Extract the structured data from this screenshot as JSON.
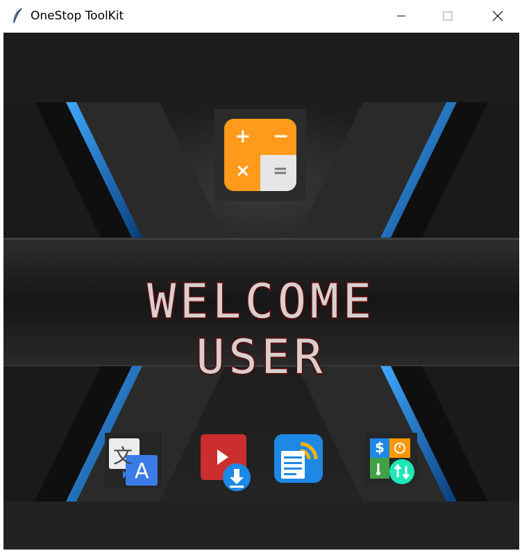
{
  "window": {
    "title": "OneStop ToolKit",
    "icons": {
      "app": "feather-icon",
      "minimize": "minimize-icon",
      "maximize": "maximize-icon",
      "close": "close-icon"
    }
  },
  "main": {
    "welcome_line1": "WELCOME",
    "welcome_line2": "USER"
  },
  "tools": {
    "calculator": {
      "icon": "calculator-icon",
      "symbols": [
        "+",
        "−",
        "×",
        "="
      ]
    },
    "translator": {
      "icon": "translate-icon",
      "glyph_cjk": "文",
      "glyph_latin": "A"
    },
    "video_downloader": {
      "icon": "video-download-icon"
    },
    "reader": {
      "icon": "rss-reader-icon"
    },
    "unit_converter": {
      "icon": "unit-converter-icon",
      "glyph_dollar": "$"
    }
  },
  "colors": {
    "accent_blue": "#1e90ff",
    "welcome_outline": "#7a1010",
    "calculator_orange": "#ff9a1a",
    "video_red": "#cc2e2e",
    "reader_blue": "#1e88e5"
  }
}
